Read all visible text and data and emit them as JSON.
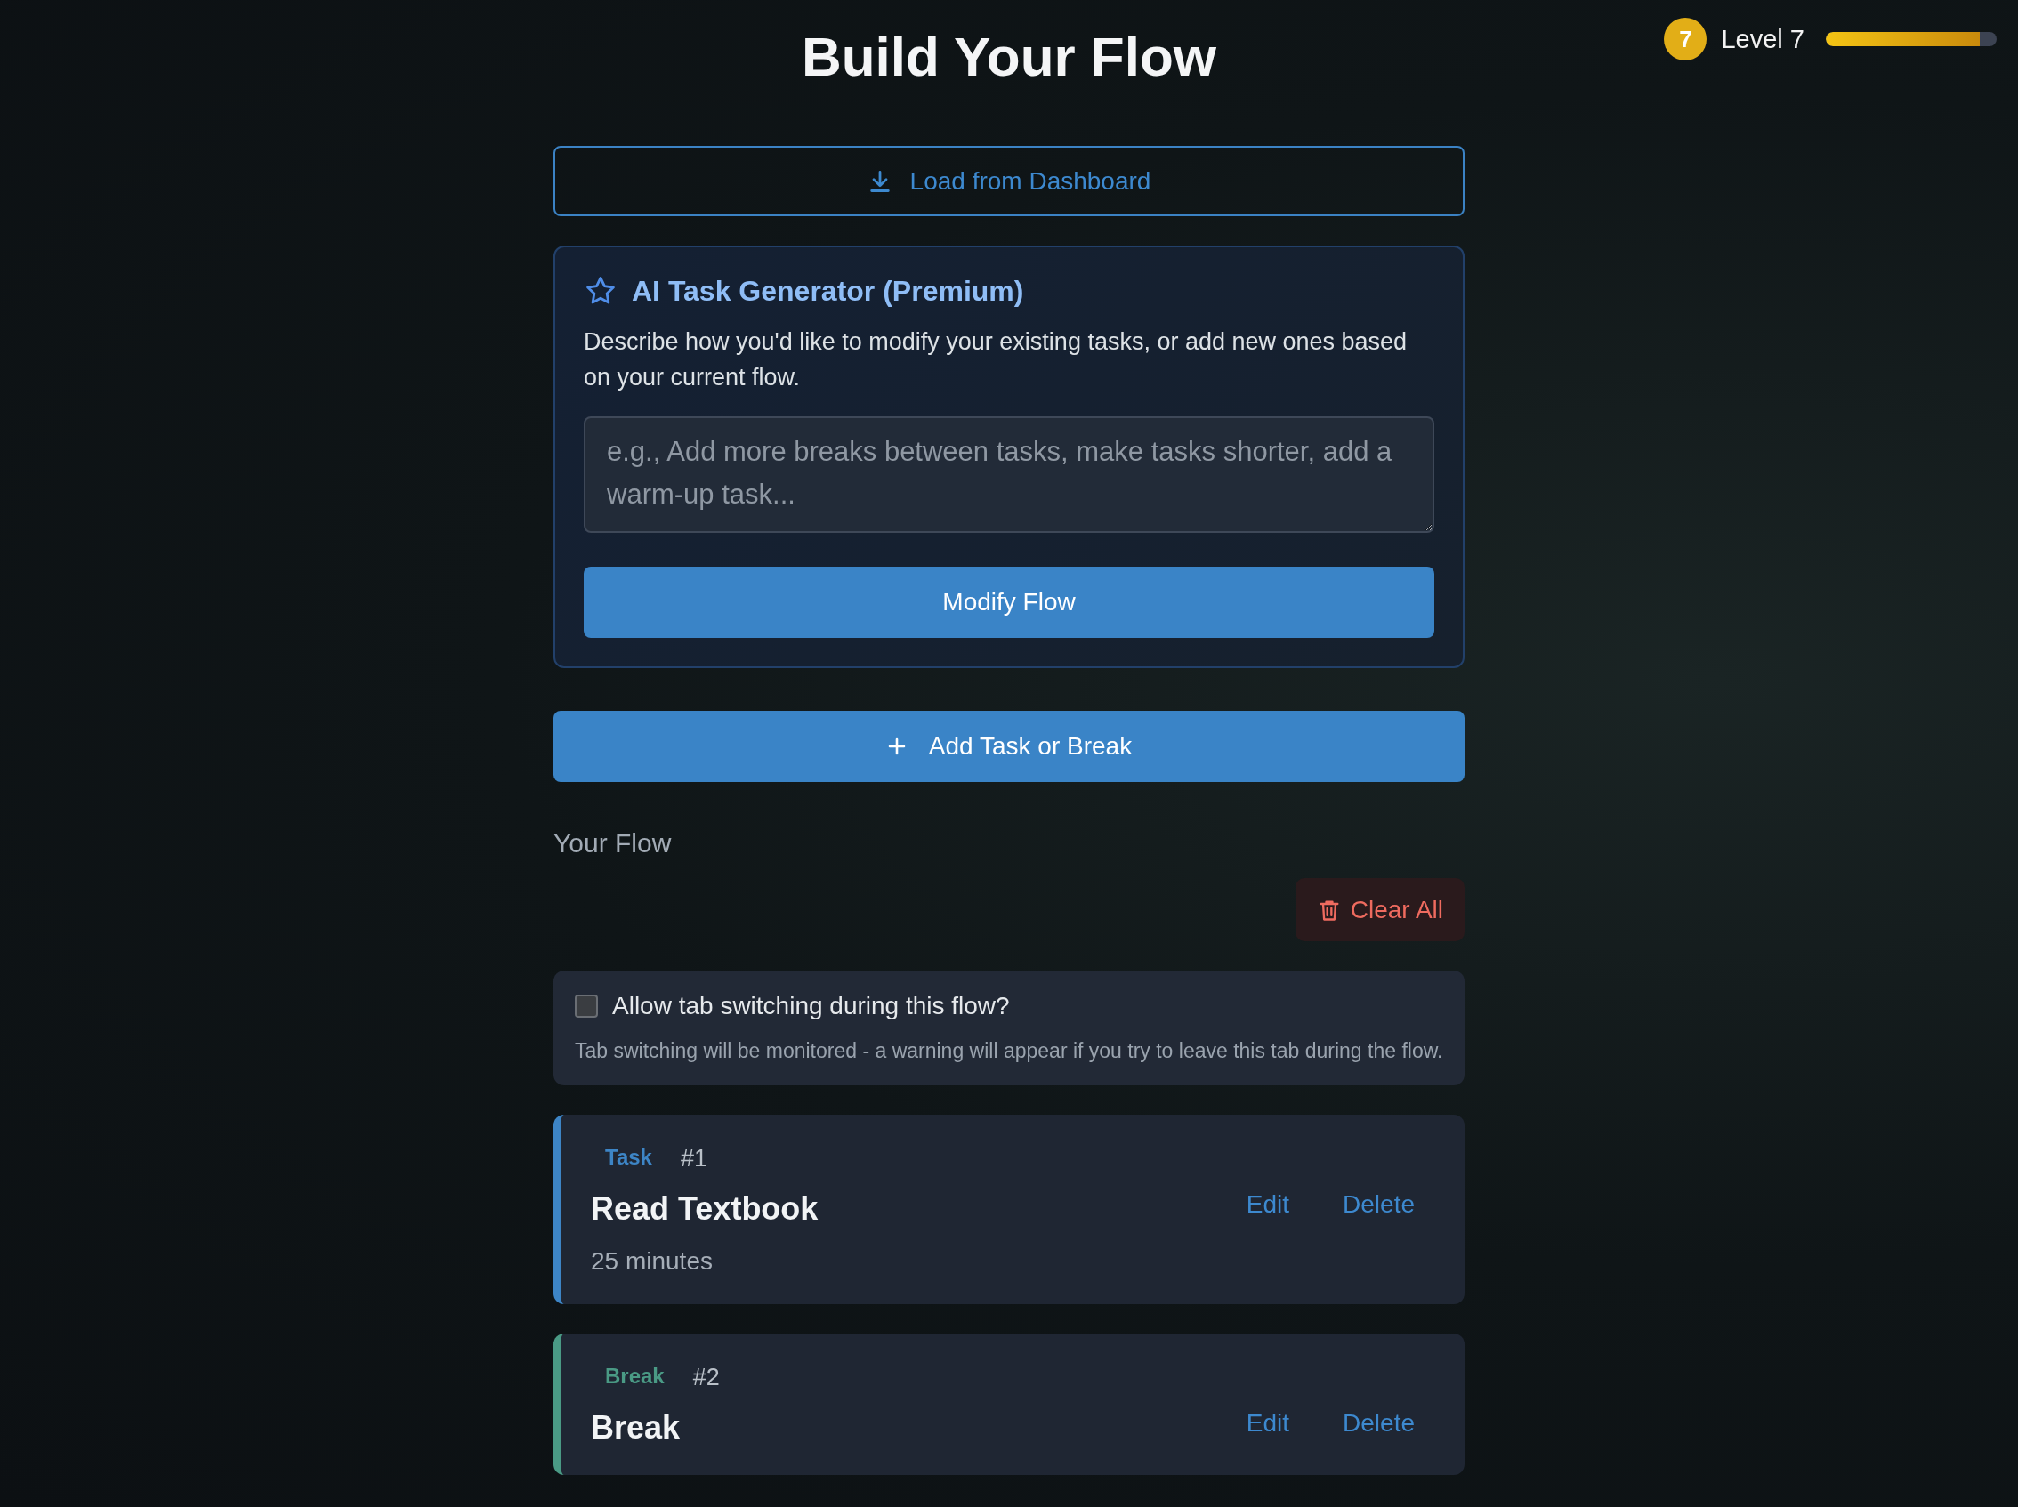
{
  "title": "Build Your Flow",
  "level": {
    "badge": "7",
    "label": "Level 7",
    "level": 0.9
  },
  "load_button": "Load from Dashboard",
  "ai_generator": {
    "title": "AI Task Generator (Premium)",
    "description": "Describe how you'd like to modify your existing tasks, or add new ones based on your current flow.",
    "placeholder": "e.g., Add more breaks between tasks, make tasks shorter, add a warm-up task...",
    "button": "Modify Flow"
  },
  "add_button": "Add Task or Break",
  "flow_heading": "Your Flow",
  "clear_button": "Clear All",
  "tab_switching": {
    "label": "Allow tab switching during this flow?",
    "checked": false,
    "note": "Tab switching will be monitored - a warning will appear if you try to leave this tab during the flow."
  },
  "items": [
    {
      "kind": "task",
      "type": "Task",
      "number": "#1",
      "title": "Read Textbook",
      "duration": "25 minutes",
      "edit": "Edit",
      "delete": "Delete"
    },
    {
      "kind": "break",
      "type": "Break",
      "number": "#2",
      "title": "Break",
      "edit": "Edit",
      "delete": "Delete"
    }
  ]
}
